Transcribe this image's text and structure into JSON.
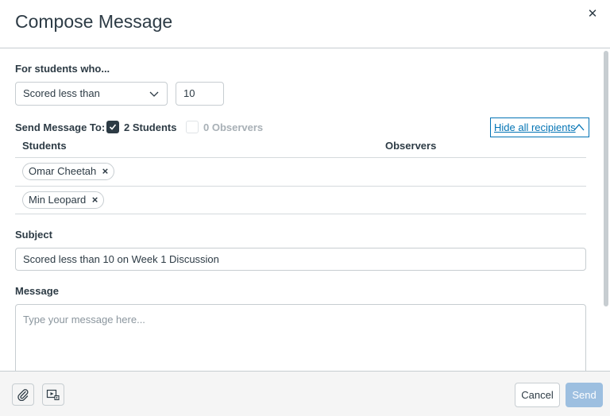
{
  "header": {
    "title": "Compose Message"
  },
  "criteria": {
    "label": "For students who...",
    "select_value": "Scored less than",
    "score_value": "10"
  },
  "recipients": {
    "label": "Send Message To:",
    "students_option": "2 Students",
    "students_checked": true,
    "observers_option": "0 Observers",
    "observers_checked": false,
    "hide_button": "Hide all recipients",
    "col_students": "Students",
    "col_observers": "Observers",
    "students": [
      {
        "name": "Omar Cheetah"
      },
      {
        "name": "Min Leopard"
      }
    ]
  },
  "subject": {
    "label": "Subject",
    "value": "Scored less than 10 on Week 1 Discussion"
  },
  "message": {
    "label": "Message",
    "placeholder": "Type your message here..."
  },
  "footer": {
    "cancel_label": "Cancel",
    "send_label": "Send"
  },
  "icons": {
    "close": "close-icon",
    "attach": "paperclip-icon",
    "media": "media-record-icon",
    "select": "chevron-down-icon",
    "hide": "chevron-up-icon"
  },
  "colors": {
    "link": "#0374b5",
    "send_disabled": "#9dbfe0",
    "text": "#2d3b45"
  }
}
